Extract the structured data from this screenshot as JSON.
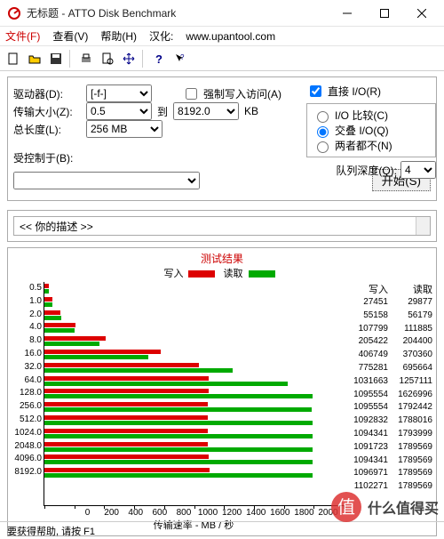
{
  "window": {
    "title": "无标题 - ATTO Disk Benchmark"
  },
  "menu": {
    "file": "文件(F)",
    "view": "查看(V)",
    "help": "帮助(H)",
    "credit_label": "汉化:",
    "credit_url": "www.upantool.com"
  },
  "controls": {
    "drive_label": "驱动器(D):",
    "drive_value": "[-f-]",
    "force_write_label": "强制写入访问(A)",
    "direct_io_label": "直接 I/O(R)",
    "transfer_label": "传输大小(Z):",
    "transfer_from": "0.5",
    "to_label": "到",
    "transfer_to": "8192.0",
    "unit": "KB",
    "length_label": "总长度(L):",
    "length_value": "256 MB",
    "io_compare": "I/O 比较(C)",
    "io_overlap": "交叠 I/O(Q)",
    "io_neither": "两者都不(N)",
    "queue_label": "队列深度(Q):",
    "queue_value": "4",
    "controlled_label": "受控制于(B):",
    "controlled_value": "",
    "start_label": "开始(S)"
  },
  "desc": {
    "placeholder": "<<  你的描述  >>"
  },
  "results": {
    "title": "测试结果",
    "write_label": "写入",
    "read_label": "读取",
    "xlabel": "传输速率 - MB / 秒",
    "xmax": 2000,
    "xticks": [
      "0",
      "200",
      "400",
      "600",
      "800",
      "1000",
      "1200",
      "1400",
      "1600",
      "1800",
      "2000"
    ],
    "col_write": "写入",
    "col_read": "读取"
  },
  "chart_data": {
    "type": "bar",
    "title": "测试结果",
    "xlabel": "传输速率 - MB / 秒",
    "ylabel": "",
    "xlim": [
      0,
      2000
    ],
    "categories": [
      "0.5",
      "1.0",
      "2.0",
      "4.0",
      "8.0",
      "16.0",
      "32.0",
      "64.0",
      "128.0",
      "256.0",
      "512.0",
      "1024.0",
      "2048.0",
      "4096.0",
      "8192.0"
    ],
    "series": [
      {
        "name": "写入",
        "color": "#d00000",
        "values": [
          27451,
          55158,
          107799,
          205422,
          406749,
          775281,
          1031663,
          1095554,
          1095554,
          1092832,
          1094341,
          1091723,
          1094341,
          1096971,
          1102271
        ],
        "values_kb": [
          27.451,
          55.158,
          107.799,
          205.422,
          406.749,
          775.281,
          1031.663,
          1095.554,
          1095.554,
          1092.832,
          1094.341,
          1091.723,
          1094.341,
          1096.971,
          1102.271
        ]
      },
      {
        "name": "读取",
        "color": "#00a000",
        "values": [
          29877,
          56179,
          111885,
          204400,
          370360,
          695664,
          1257111,
          1626996,
          1792442,
          1788016,
          1793999,
          1789569,
          1789569,
          1789569,
          1789569
        ],
        "values_kb": [
          29.877,
          56.179,
          111.885,
          204.4,
          370.36,
          695.664,
          1257.111,
          1626.996,
          1792.442,
          1788.016,
          1793.999,
          1789.569,
          1789.569,
          1789.569,
          1789.569
        ]
      }
    ]
  },
  "statusbar": {
    "text": "要获得帮助, 请按 F1"
  },
  "watermark": {
    "brand": "值",
    "text": "什么值得买"
  }
}
